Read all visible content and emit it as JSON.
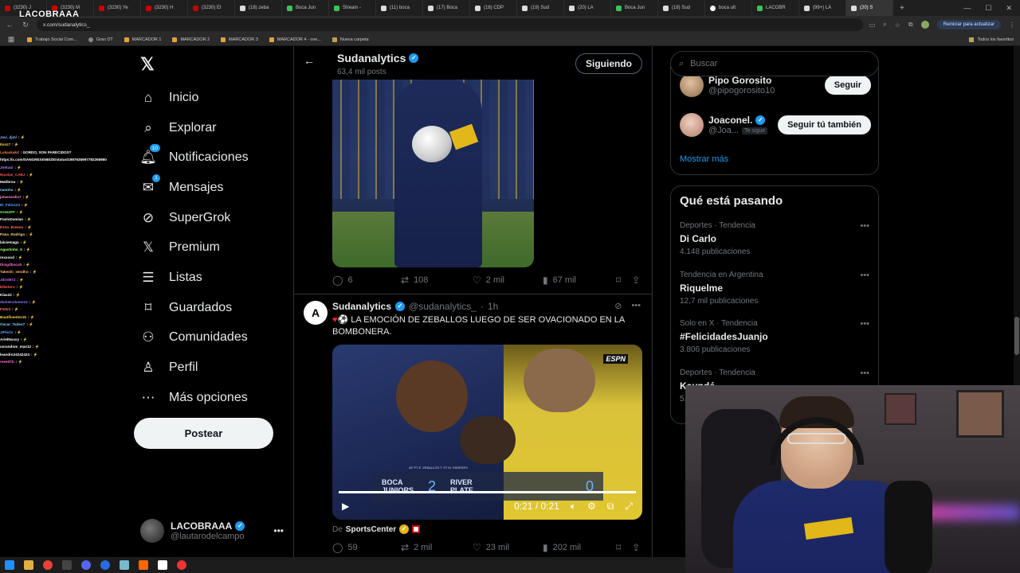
{
  "browser": {
    "tabs": [
      {
        "label": "(3230) J",
        "icon": "youtube"
      },
      {
        "label": "(3230) M",
        "icon": "youtube"
      },
      {
        "label": "(3230) Ye",
        "icon": "youtube"
      },
      {
        "label": "(3230) H",
        "icon": "youtube"
      },
      {
        "label": "(3230) El",
        "icon": "youtube"
      },
      {
        "label": "(18) zeba",
        "icon": "x"
      },
      {
        "label": "Boca Jun",
        "icon": "green"
      },
      {
        "label": "Stream -",
        "icon": "green"
      },
      {
        "label": "(11) boca",
        "icon": "x"
      },
      {
        "label": "(17) Boca",
        "icon": "x"
      },
      {
        "label": "(18) CDP",
        "icon": "x"
      },
      {
        "label": "(19) Sud",
        "icon": "x"
      },
      {
        "label": "(20) LA",
        "icon": "x"
      },
      {
        "label": "Boca Jun",
        "icon": "green"
      },
      {
        "label": "(18) Sud",
        "icon": "x"
      },
      {
        "label": "boca ult",
        "icon": "google"
      },
      {
        "label": "LACOBR",
        "icon": "green"
      },
      {
        "label": "(99+) LA",
        "icon": "x"
      },
      {
        "label": "(20) S",
        "icon": "x"
      }
    ],
    "url": "x.com/sudanalytics_",
    "update_button": "Reiniciar para actualizar",
    "bookmarks": [
      {
        "label": "Trabajo Social Com...",
        "icon": "bookmark"
      },
      {
        "label": "Gran DT",
        "icon": "globe"
      },
      {
        "label": "MARCADOR 1",
        "icon": "bookmark"
      },
      {
        "label": "MARCADOR 2",
        "icon": "bookmark"
      },
      {
        "label": "MARCADOR 3",
        "icon": "bookmark"
      },
      {
        "label": "MARCADOR 4 - ove...",
        "icon": "bookmark"
      },
      {
        "label": "Nueva carpeta",
        "icon": "folder"
      }
    ],
    "all_bookmarks": "Todos los favoritos"
  },
  "overlay": {
    "stream_name": "LACOBRAAA",
    "chat": [
      {
        "user": "Javi_djmi",
        "msg": "",
        "color": "#8ab4ff"
      },
      {
        "user": "Ilonz7",
        "msg": "",
        "color": "#ffd54a"
      },
      {
        "user": "Lukaskakd",
        "msg": "GORDO, SON PARECIDOS?",
        "color": "#ff7a59"
      },
      {
        "user": "",
        "msg": "https://x.com/SANGREXENEIZE/status/1987635997782265980",
        "color": "#ffffff"
      },
      {
        "user": "JinKaxi",
        "msg": "",
        "color": "#b388ff"
      },
      {
        "user": "Nicolas_CABJ",
        "msg": "",
        "color": "#ff5a5a"
      },
      {
        "user": "Matibrou",
        "msg": "",
        "color": "#ffffff"
      },
      {
        "user": "nanoho",
        "msg": "",
        "color": "#7fd3ff"
      },
      {
        "user": "joluensolis7",
        "msg": "",
        "color": "#ff8ad8"
      },
      {
        "user": "El_Felix123",
        "msg": "",
        "color": "#5aa2ff"
      },
      {
        "user": "GreenFF",
        "msg": "",
        "color": "#7dff7a"
      },
      {
        "user": "PaoloDamian",
        "msg": "",
        "color": "#ffffff"
      },
      {
        "user": "E1na_Breeon",
        "msg": "",
        "color": "#ff6b6b"
      },
      {
        "user": "Pana_Rodrigo",
        "msg": "",
        "color": "#ffd27a"
      },
      {
        "user": "lalciemaga",
        "msg": "",
        "color": "#ffffff"
      },
      {
        "user": "Agustinho_5",
        "msg": "",
        "color": "#a6ff7a"
      },
      {
        "user": "rexxood",
        "msg": "",
        "color": "#ffffff"
      },
      {
        "user": "thisgdbocah",
        "msg": "",
        "color": "#ff6bd6"
      },
      {
        "user": "Takeshi_sendho",
        "msg": "",
        "color": "#ffb36b"
      },
      {
        "user": "Jdrrd672",
        "msg": "",
        "color": "#c06bff"
      },
      {
        "user": "Elbetoro",
        "msg": "",
        "color": "#ff5a5a"
      },
      {
        "user": "Klax22",
        "msg": "",
        "color": "#ffffff"
      },
      {
        "user": "danielcolumns2",
        "msg": "",
        "color": "#8a7cff"
      },
      {
        "user": "F10v3",
        "msg": "",
        "color": "#ff7a7a"
      },
      {
        "user": "Bautifuentes15",
        "msg": "",
        "color": "#ffd54a"
      },
      {
        "user": "Oscar_Tadeo7",
        "msg": "",
        "color": "#7fd3ff"
      },
      {
        "user": "JtPierix",
        "msg": "",
        "color": "#5aa2ff"
      },
      {
        "user": "ArielNuxxy",
        "msg": "",
        "color": "#ffffff"
      },
      {
        "user": "usrandom_mas12",
        "msg": "",
        "color": "#ffffff"
      },
      {
        "user": "leandro24242424",
        "msg": "",
        "color": "#ffffff"
      },
      {
        "user": "reeed7b",
        "msg": "",
        "color": "#ff6bd6"
      }
    ]
  },
  "left_nav": {
    "items": [
      {
        "label": "Inicio",
        "icon": "home-icon"
      },
      {
        "label": "Explorar",
        "icon": "search-icon"
      },
      {
        "label": "Notificaciones",
        "icon": "bell-icon",
        "badge": "10"
      },
      {
        "label": "Mensajes",
        "icon": "mail-icon",
        "badge": "1"
      },
      {
        "label": "SuperGrok",
        "icon": "grok-icon"
      },
      {
        "label": "Premium",
        "icon": "x-icon"
      },
      {
        "label": "Listas",
        "icon": "list-icon"
      },
      {
        "label": "Guardados",
        "icon": "bookmark-icon"
      },
      {
        "label": "Comunidades",
        "icon": "people-icon"
      },
      {
        "label": "Perfil",
        "icon": "person-icon"
      },
      {
        "label": "Más opciones",
        "icon": "more-icon"
      }
    ],
    "post_button": "Postear",
    "account": {
      "name": "LACOBRAAA",
      "handle": "@lautarodelcampo"
    }
  },
  "profile_header": {
    "name": "Sudanalytics",
    "posts_count": "63,4 mil posts",
    "follow_button": "Siguiendo"
  },
  "tweet1": {
    "replies": "6",
    "reposts": "108",
    "likes": "2 mil",
    "views": "67 mil"
  },
  "tweet2": {
    "author": "Sudanalytics",
    "avatar_letter": "A",
    "handle": "@sudanalytics_",
    "time": "1h",
    "text": "LA EMOCIÓN DE ZEBALLOS LUEGO DE SER OVACIONADO EN LA BOMBONERA.",
    "video": {
      "broadcaster": "ESPN",
      "scorebug_sub": "45' PT  E. ZEBALLOS   7' ST  M. PAREDES",
      "home_team": "BOCA JUNIORS",
      "home_score": "2",
      "away_team": "RIVER PLATE",
      "away_score": "0",
      "time": "0:21 / 0:21",
      "progress": 1.0
    },
    "source_prefix": "De",
    "source": "SportsCenter",
    "replies": "59",
    "reposts": "2 mil",
    "likes": "23 mil",
    "views": "202 mil"
  },
  "right": {
    "search_placeholder": "Buscar",
    "follow_suggestions": [
      {
        "name": "Pipo Gorosito",
        "handle": "@pipogorosito10",
        "button": "Seguir",
        "verified": false,
        "follows_you": ""
      },
      {
        "name": "Joaconel.",
        "handle": "@Joa...",
        "button": "Seguir tú también",
        "verified": true,
        "follows_you": "Te sigue"
      }
    ],
    "show_more": "Mostrar más",
    "trends_title": "Qué está pasando",
    "trends": [
      {
        "context": "Deportes · Tendencia",
        "name": "Di Carlo",
        "count": "4.148 publicaciones"
      },
      {
        "context": "Tendencia en Argentina",
        "name": "Riquelme",
        "count": "12,7 mil publicaciones"
      },
      {
        "context": "Solo en X · Tendencia",
        "name": "#FelicidadesJuanjo",
        "count": "3.806 publicaciones"
      },
      {
        "context": "Deportes · Tendencia",
        "name": "Kaundé",
        "count": "5..."
      }
    ]
  },
  "colors": {
    "accent": "#1d9bf0",
    "background": "#000000",
    "border": "#2f3336",
    "muted": "#71767b"
  }
}
